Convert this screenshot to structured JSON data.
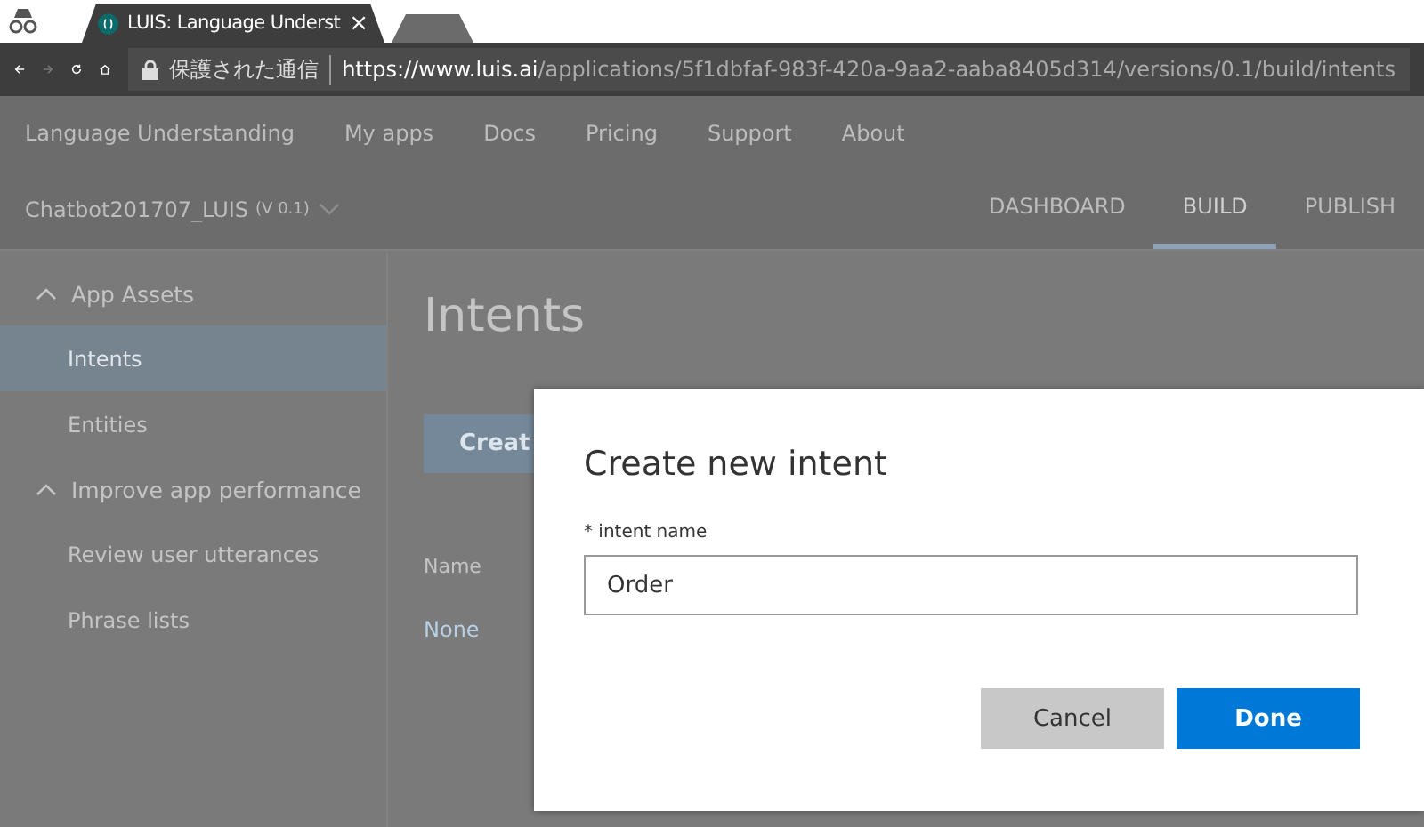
{
  "browser": {
    "tabs": [
      {
        "title": "LUIS: Language Underst",
        "selected": true,
        "close": "×"
      },
      {
        "selected": false
      }
    ],
    "security_label": "保護された通信",
    "url_host": "https://www.luis.ai",
    "url_path": "/applications/5f1dbfaf-983f-420a-9aa2-aaba8405d314/versions/0.1/build/intents"
  },
  "nav": [
    "Language Understanding",
    "My apps",
    "Docs",
    "Pricing",
    "Support",
    "About"
  ],
  "app_bar": {
    "app_name": "Chatbot201707_LUIS",
    "version": "(V 0.1)",
    "tabs": [
      {
        "label": "DASHBOARD",
        "selected": false
      },
      {
        "label": "BUILD",
        "selected": true
      },
      {
        "label": "PUBLISH",
        "selected": false
      }
    ]
  },
  "sidebar": [
    {
      "label": "App Assets",
      "expanded": true,
      "children": [
        {
          "label": "Intents",
          "selected": true
        },
        {
          "label": "Entities",
          "selected": false
        }
      ]
    },
    {
      "label": "Improve app performance",
      "expanded": true,
      "children": [
        {
          "label": "Review user utterances",
          "selected": false
        },
        {
          "label": "Phrase lists",
          "selected": false
        }
      ]
    }
  ],
  "main": {
    "title": "Intents",
    "create_button": "Creat",
    "column": "Name",
    "rows": [
      "None"
    ]
  },
  "dialog": {
    "title": "Create new intent",
    "field_label": "* intent name",
    "field_value": "Order",
    "buttons": [
      {
        "label": "Cancel",
        "kind": "secondary"
      },
      {
        "label": "Done",
        "kind": "primary"
      }
    ]
  }
}
